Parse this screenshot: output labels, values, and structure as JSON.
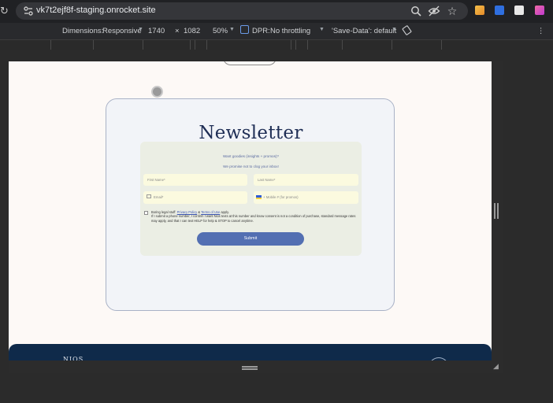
{
  "browser": {
    "url": "vk7t2ejf8f-staging.onrocket.site"
  },
  "devtools": {
    "dimensions_label": "Dimensions:",
    "dimensions_value": "Responsive",
    "width": "1740",
    "times": "×",
    "height": "1082",
    "zoom": "50%",
    "dpr_label": "DPR:",
    "throttling": "No throttling",
    "save_data": "'Save-Data': default",
    "more": "⋮"
  },
  "page": {
    "title": "Newsletter",
    "tagline_1": "Want goodies (insights + promos)?",
    "tagline_2": "We promise not to clog your inbox!",
    "fields": {
      "first_name": "First Name*",
      "last_name": "Last Name*",
      "email": "Email*",
      "phone": "+ Mobile # (for promos)"
    },
    "legal_prefix": "Boring legal stuff: ",
    "privacy_policy": "Privacy Policy",
    "amp": " & ",
    "terms": "Terms of Use",
    "legal_apply": " apply.",
    "legal_body": "If I submit a phone number, I confirm I want Nios texts at this number and know consent is not a condition of purchase, standard message rates may apply, and that I can text HELP for help & STOP to cancel anytime.",
    "submit_label": "Submit",
    "footer_brand": "NIOS"
  },
  "colors": {
    "accent": "#536fb2",
    "title": "#1f2e55",
    "footer": "#0f2a4a",
    "page_bg": "#fdf9f6"
  }
}
